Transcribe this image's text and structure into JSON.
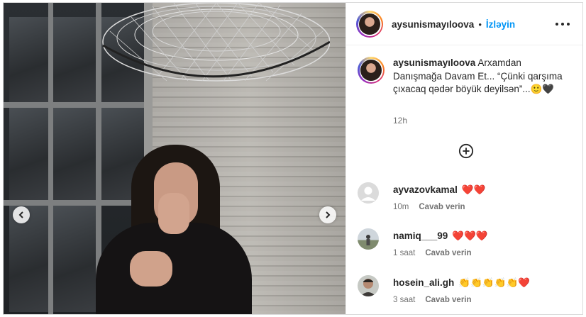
{
  "post": {
    "username": "aysunismayıloova",
    "separator": "•",
    "follow_label": "İzləyin",
    "more_icon": "more-horizontal-icon"
  },
  "caption": {
    "username": "aysunismayıloova",
    "text": "Arxamdan Danışmağa Davam Et... “Çünki qarşıma çıxacaq qədər böyük deyilsən”...🙂🖤",
    "time": "12h"
  },
  "load_more_icon": "plus-circle-icon",
  "comments": [
    {
      "username": "ayvazovkamal",
      "text": "❤️❤️",
      "time": "10m",
      "reply": "Cavab verin"
    },
    {
      "username": "namiq___99",
      "text": "❤️❤️❤️",
      "time": "1 saat",
      "reply": "Cavab verin"
    },
    {
      "username": "hosein_ali.gh",
      "text": "👏👏👏👏👏❤️",
      "time": "3 saat",
      "reply": "Cavab verin"
    }
  ],
  "colors": {
    "follow": "#0095f6",
    "text": "#262626",
    "muted": "#737373",
    "border": "#dbdbdb"
  }
}
